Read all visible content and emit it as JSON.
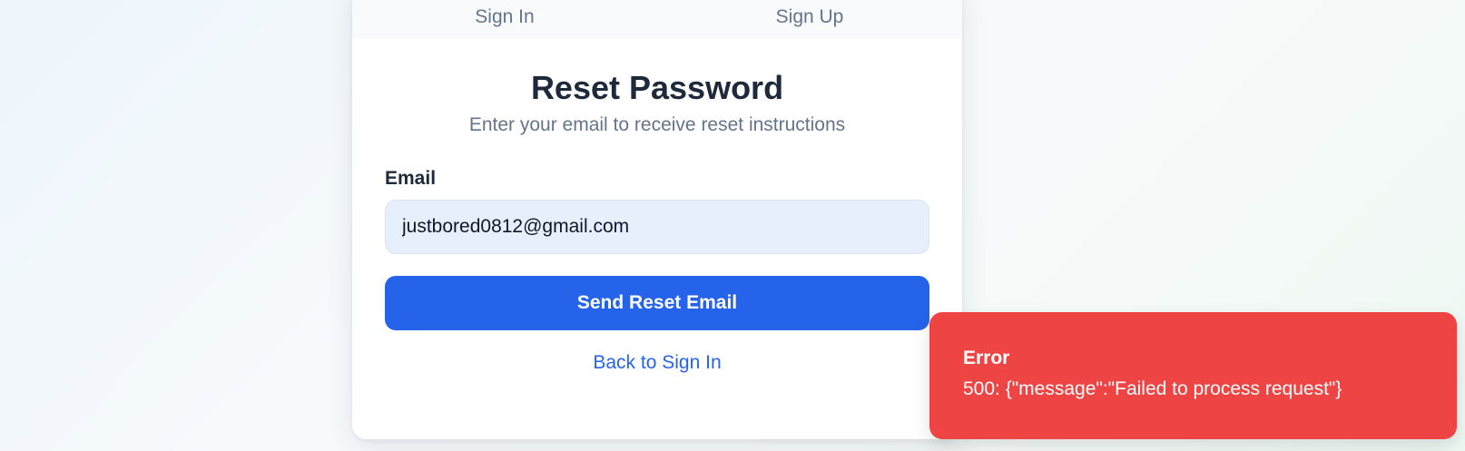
{
  "tabs": {
    "sign_in": "Sign In",
    "sign_up": "Sign Up"
  },
  "form": {
    "title": "Reset Password",
    "subtitle": "Enter your email to receive reset instructions",
    "email_label": "Email",
    "email_value": "justbored0812@gmail.com",
    "submit_label": "Send Reset Email",
    "back_link": "Back to Sign In"
  },
  "toast": {
    "title": "Error",
    "message": "500: {\"message\":\"Failed to process request\"}"
  },
  "colors": {
    "primary": "#2563eb",
    "error": "#ef4444",
    "input_bg": "#e8effc",
    "text_dark": "#1e293b",
    "text_muted": "#64748b"
  }
}
